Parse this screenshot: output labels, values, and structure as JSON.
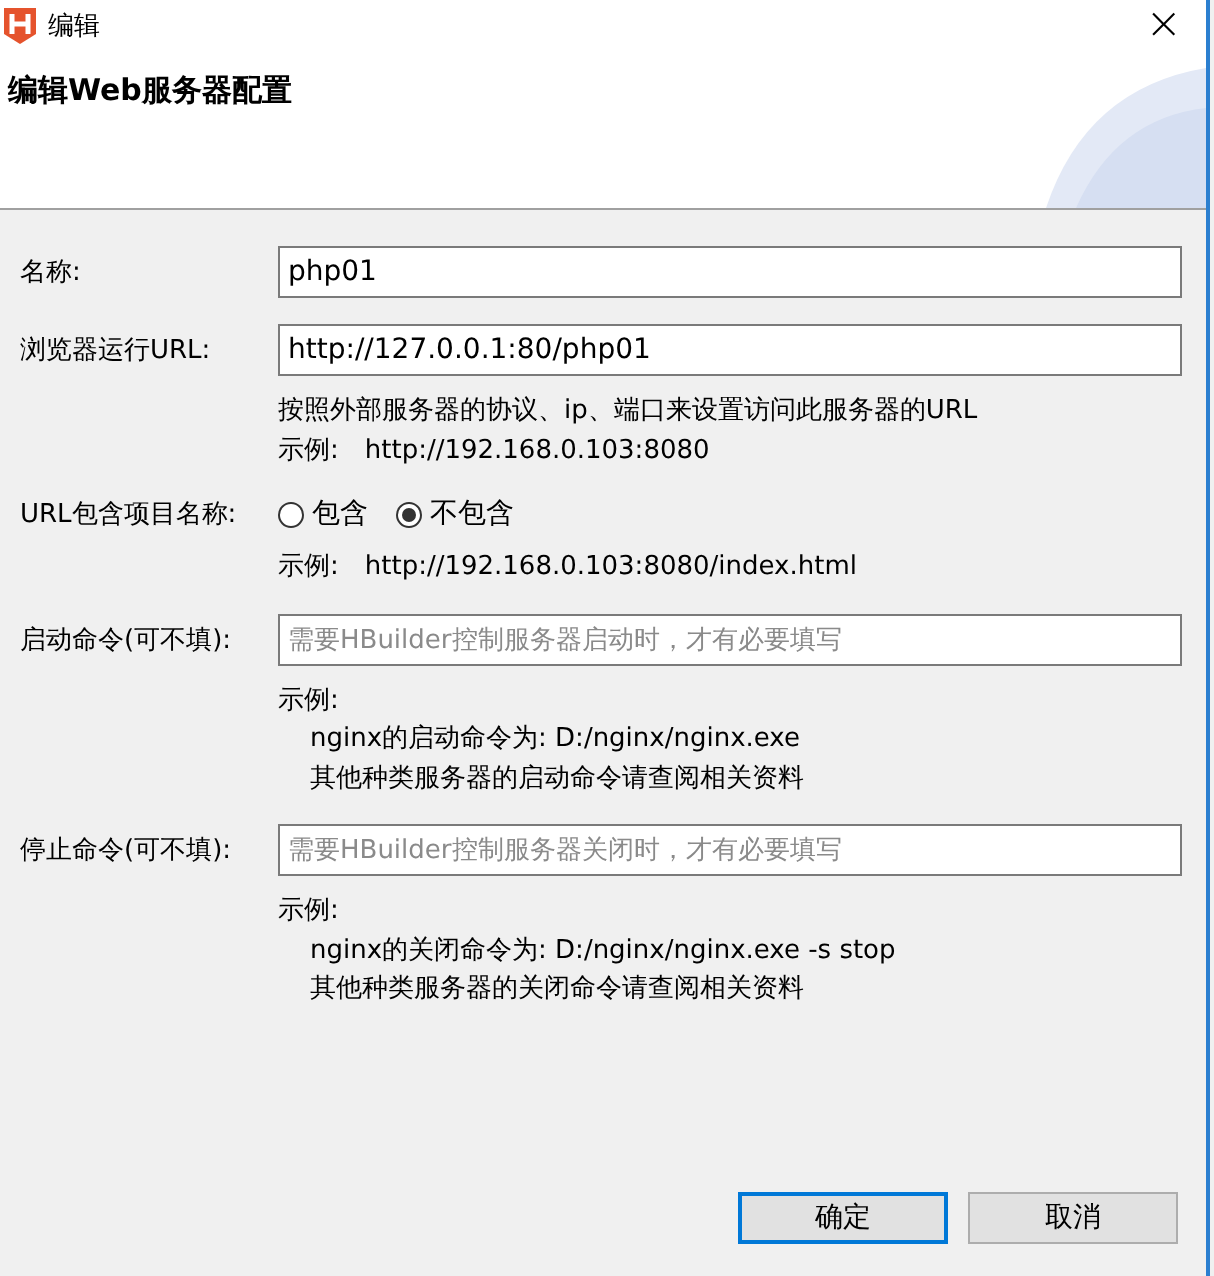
{
  "window": {
    "title": "编辑",
    "close": "×"
  },
  "header": {
    "title": "编辑Web服务器配置"
  },
  "rows": [
    {
      "kind": "input",
      "label": "名称:",
      "value": "php01",
      "notes": []
    },
    {
      "kind": "input",
      "label": "浏览器运行URL:",
      "value": "http://127.0.0.1:80/php01",
      "notes": [
        {
          "text": "按照外部服务器的协议、ip、端口来设置访问此服务器的URL",
          "indent": false
        },
        {
          "text": "示例:　http://192.168.0.103:8080",
          "indent": false
        }
      ]
    },
    {
      "kind": "radio",
      "label": "URL包含项目名称:",
      "options": [
        {
          "label": "包含",
          "selected": false
        },
        {
          "label": "不包含",
          "selected": true
        }
      ],
      "notes": [
        {
          "text": "示例:　http://192.168.0.103:8080/index.html",
          "indent": false
        }
      ]
    },
    {
      "kind": "input",
      "label": "启动命令(可不填):",
      "placeholder": "需要HBuilder控制服务器启动时，才有必要填写",
      "notes": [
        {
          "text": "示例:",
          "indent": false
        },
        {
          "text": "nginx的启动命令为:  D:/nginx/nginx.exe",
          "indent": true
        },
        {
          "text": "其他种类服务器的启动命令请查阅相关资料",
          "indent": true
        }
      ]
    },
    {
      "kind": "input",
      "label": "停止命令(可不填):",
      "placeholder": "需要HBuilder控制服务器关闭时，才有必要填写",
      "notes": [
        {
          "text": "示例:",
          "indent": false
        },
        {
          "text": "nginx的关闭命令为:  D:/nginx/nginx.exe -s stop",
          "indent": true
        },
        {
          "text": "其他种类服务器的关闭命令请查阅相关资料",
          "indent": true
        }
      ]
    }
  ],
  "buttons": [
    {
      "label": "确定",
      "default": true
    },
    {
      "label": "取消",
      "default": false
    }
  ]
}
